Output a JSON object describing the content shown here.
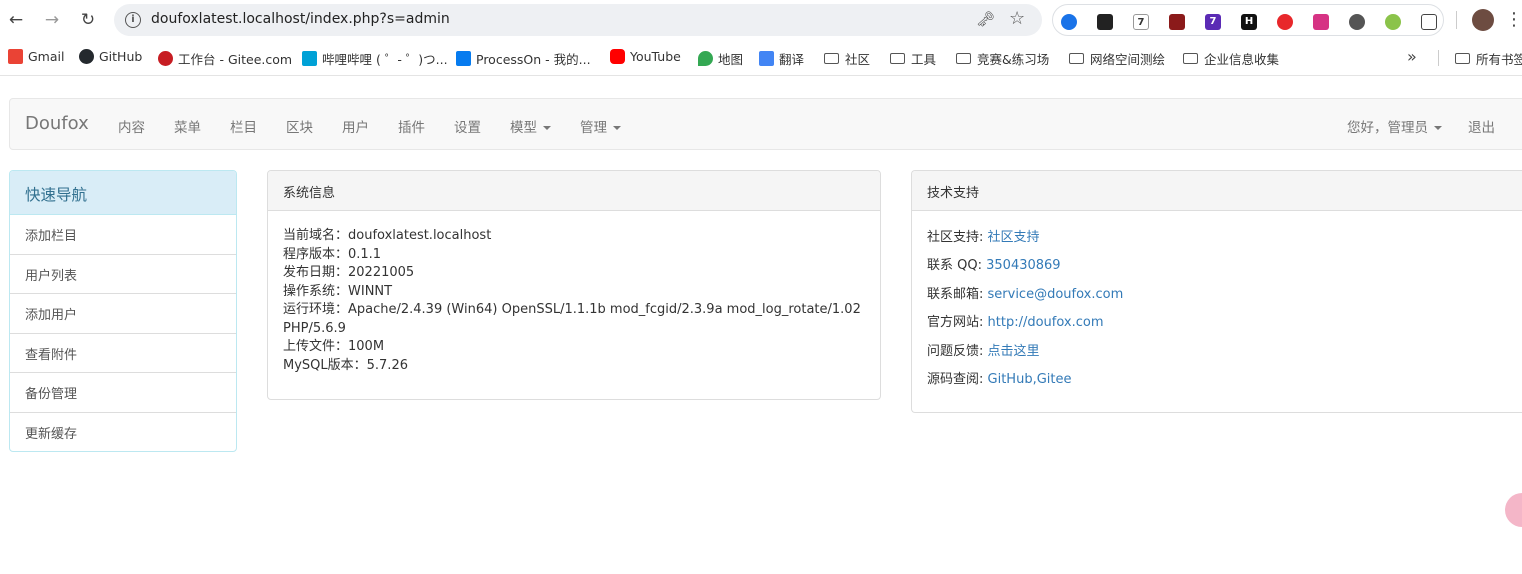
{
  "browser": {
    "url": "doufoxlatest.localhost/index.php?s=admin",
    "back_icon": "back-arrow-icon",
    "forward_icon": "forward-arrow-icon",
    "reload_icon": "reload-icon",
    "extension_badges": [
      "7",
      "7"
    ],
    "bookmarks": [
      {
        "label": "Gmail",
        "color": "#ea4335"
      },
      {
        "label": "GitHub",
        "color": "#24292e"
      },
      {
        "label": "工作台 - Gitee.com",
        "color": "#c71d23"
      },
      {
        "label": "哔哩哔哩 ( ゜- ゜)つ...",
        "color": "#00a1d6"
      },
      {
        "label": "ProcessOn - 我的...",
        "color": "#067bef"
      },
      {
        "label": "YouTube",
        "color": "#ff0000"
      },
      {
        "label": "地图",
        "color": "#34a853"
      },
      {
        "label": "翻译",
        "color": "#4285f4"
      }
    ],
    "bookmark_folders": [
      "社区",
      "工具",
      "竞赛&练习场",
      "网络空间测绘",
      "企业信息收集"
    ],
    "other_bookmarks": "所有书签"
  },
  "nav": {
    "brand": "Doufox",
    "links": [
      "内容",
      "菜单",
      "栏目",
      "区块",
      "用户",
      "插件",
      "设置"
    ],
    "dropdowns": [
      "模型",
      "管理"
    ],
    "greeting": "您好，管理员",
    "logout": "退出"
  },
  "quicknav": {
    "title": "快速导航",
    "items": [
      "添加栏目",
      "用户列表",
      "添加用户",
      "查看附件",
      "备份管理",
      "更新缓存"
    ]
  },
  "sysinfo": {
    "title": "系统信息",
    "lines": [
      "当前域名：doufoxlatest.localhost",
      "程序版本：0.1.1",
      "发布日期：20221005",
      "操作系统：WINNT",
      "运行环境：Apache/2.4.39 (Win64) OpenSSL/1.1.1b mod_fcgid/2.3.9a mod_log_rotate/1.02",
      "PHP/5.6.9",
      "上传文件：100M",
      "MySQL版本：5.7.26"
    ]
  },
  "support": {
    "title": "技术支持",
    "rows": [
      {
        "label": "社区支持: ",
        "value": "社区支持"
      },
      {
        "label": "联系 QQ: ",
        "value": "350430869"
      },
      {
        "label": "联系邮箱: ",
        "value": "service@doufox.com"
      },
      {
        "label": "官方网站: ",
        "value": "http://doufox.com"
      },
      {
        "label": "问题反馈: ",
        "value": "点击这里"
      },
      {
        "label": "源码查阅: ",
        "value": "GitHub,Gitee"
      }
    ]
  }
}
